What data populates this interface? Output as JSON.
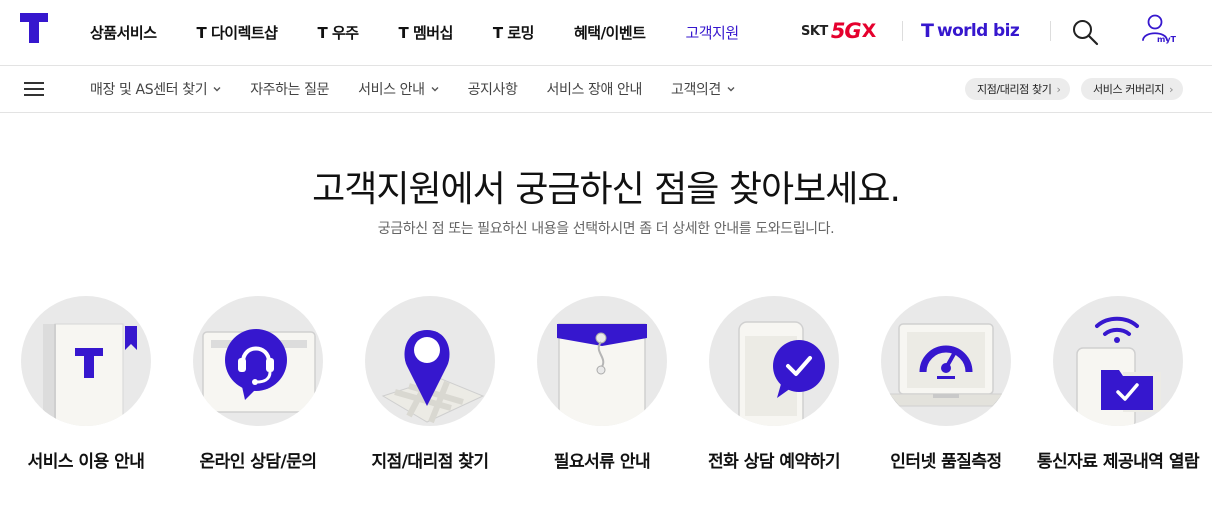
{
  "header": {
    "gnb": [
      "상품서비스",
      "T 다이렉트샵",
      "T 우주",
      "T 멤버십",
      "T 로밍",
      "혜택/이벤트",
      "고객지원"
    ],
    "skt_text": "SKT",
    "fiveg_text": "5G",
    "fiveg_mark": "X",
    "tworld_mark": "T",
    "tworld_text": "world biz",
    "myt_label": "myT"
  },
  "subnav": {
    "items": [
      "매장 및 AS센터 찾기",
      "자주하는 질문",
      "서비스 안내",
      "공지사항",
      "서비스 장애 안내",
      "고객의견"
    ],
    "pills": [
      "지점/대리점 찾기",
      "서비스 커버리지"
    ],
    "pill_arrow": "›"
  },
  "hero": {
    "title": "고객지원에서 궁금하신 점을 찾아보세요.",
    "subtitle": "궁금하신 점 또는 필요하신 내용을 선택하시면 좀 더 상세한 안내를 도와드립니다."
  },
  "cards": [
    {
      "label": "서비스 이용 안내"
    },
    {
      "label": "온라인 상담/문의"
    },
    {
      "label": "지점/대리점 찾기"
    },
    {
      "label": "필요서류 안내"
    },
    {
      "label": "전화 상담 예약하기"
    },
    {
      "label": "인터넷 품질측정"
    },
    {
      "label": "통신자료 제공내역 열람"
    }
  ],
  "colors": {
    "brand": "#3617ce",
    "fiveg_red": "#e5002d",
    "circle_bg": "#e9e9e9"
  }
}
